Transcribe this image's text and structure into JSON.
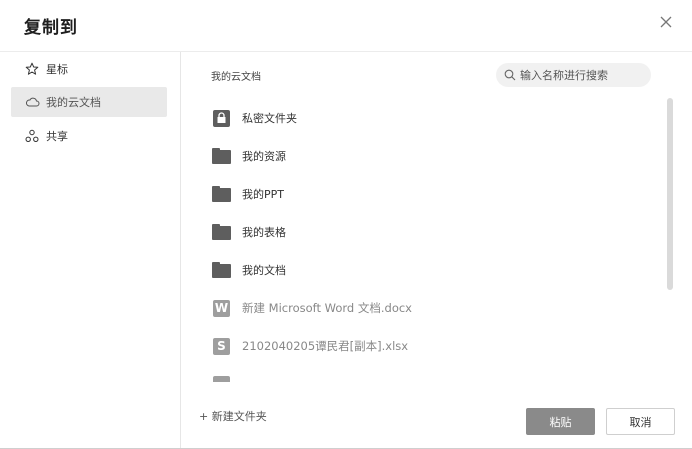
{
  "dialog": {
    "title": "复制到"
  },
  "sidebar": {
    "items": [
      {
        "label": "星标",
        "icon": "star-icon"
      },
      {
        "label": "我的云文档",
        "icon": "cloud-icon",
        "active": true
      },
      {
        "label": "共享",
        "icon": "share-icon"
      }
    ]
  },
  "breadcrumb": "我的云文档",
  "search": {
    "placeholder": "输入名称进行搜索"
  },
  "files": [
    {
      "name": "私密文件夹",
      "icon": "lock-folder-icon"
    },
    {
      "name": "我的资源",
      "icon": "folder-icon"
    },
    {
      "name": "我的PPT",
      "icon": "folder-icon"
    },
    {
      "name": "我的表格",
      "icon": "folder-icon"
    },
    {
      "name": "我的文档",
      "icon": "folder-icon"
    },
    {
      "name": "新建 Microsoft Word 文档.docx",
      "icon": "word-file-icon",
      "glyph": "W"
    },
    {
      "name": "2102040205谭民君[副本].xlsx",
      "icon": "sheet-file-icon",
      "glyph": "S"
    }
  ],
  "footer": {
    "new_folder": "+ 新建文件夹",
    "paste": "粘贴",
    "cancel": "取消"
  },
  "colors": {
    "active_bg": "#e9e9e9",
    "folder": "#5e5e5e",
    "primary_button": "#8a8a8a"
  }
}
